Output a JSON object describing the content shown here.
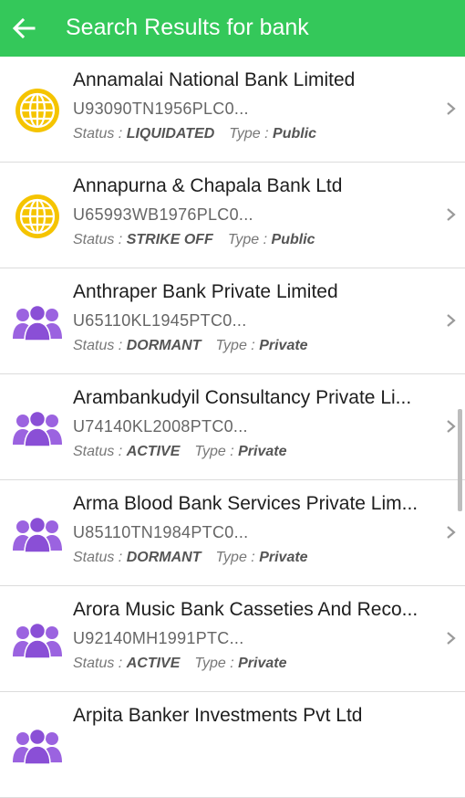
{
  "appbar": {
    "title": "Search Results for bank",
    "background": "#34c85a"
  },
  "meta_labels": {
    "status": "Status :",
    "type": "Type :"
  },
  "icons": {
    "public": "globe-icon",
    "private": "people-icon",
    "public_color": "#f5c400",
    "private_color": "#9b63e0"
  },
  "results": [
    {
      "name": "Annamalai National Bank Limited",
      "cin": "U93090TN1956PLC0...",
      "status": "LIQUIDATED",
      "type": "Public",
      "icon": "globe-icon"
    },
    {
      "name": "Annapurna & Chapala Bank Ltd",
      "cin": "U65993WB1976PLC0...",
      "status": "STRIKE OFF",
      "type": "Public",
      "icon": "globe-icon"
    },
    {
      "name": "Anthraper Bank Private Limited",
      "cin": "U65110KL1945PTC0...",
      "status": "DORMANT",
      "type": "Private",
      "icon": "people-icon"
    },
    {
      "name": "Arambankudyil Consultancy Private Li...",
      "cin": "U74140KL2008PTC0...",
      "status": "ACTIVE",
      "type": "Private",
      "icon": "people-icon"
    },
    {
      "name": "Arma Blood Bank Services Private Lim...",
      "cin": "U85110TN1984PTC0...",
      "status": "DORMANT",
      "type": "Private",
      "icon": "people-icon"
    },
    {
      "name": "Arora Music Bank Casseties And Reco...",
      "cin": "U92140MH1991PTC...",
      "status": "ACTIVE",
      "type": "Private",
      "icon": "people-icon"
    },
    {
      "name": "Arpita Banker Investments Pvt Ltd",
      "cin": "",
      "status": "",
      "type": "",
      "icon": "people-icon"
    }
  ]
}
